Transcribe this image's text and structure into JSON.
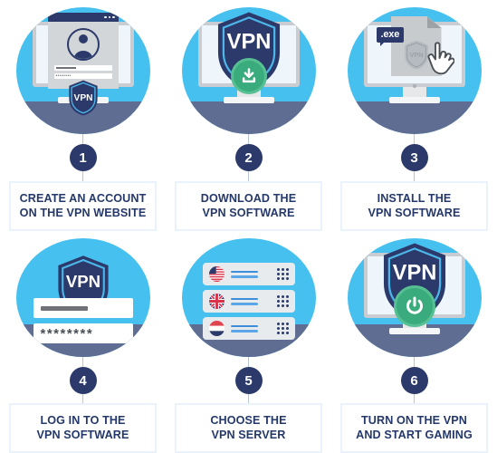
{
  "theme": {
    "circle_blue": "#45c0ef",
    "floor_slate": "#5f6d93",
    "navy": "#2b3a6b",
    "caption_text": "#25386b",
    "caption_border": "#eaf3fb",
    "green": "#3aab7c",
    "green_light": "#57c093",
    "screen_gray": "#c9cdd1"
  },
  "steps": [
    {
      "number": "1",
      "caption_line1": "CREATE AN ACCOUNT",
      "caption_line2": "ON THE VPN WEBSITE",
      "illustration": "monitor-with-login-browser",
      "shield_label": "VPN",
      "password_mask": "••••••••"
    },
    {
      "number": "2",
      "caption_line1": "DOWNLOAD THE",
      "caption_line2": "VPN SOFTWARE",
      "illustration": "monitor-with-download-shield",
      "shield_label": "VPN"
    },
    {
      "number": "3",
      "caption_line1": "INSTALL THE",
      "caption_line2": "VPN SOFTWARE",
      "illustration": "monitor-with-exe-file-and-cursor",
      "file_label": ".exe",
      "shield_label": "VPN"
    },
    {
      "number": "4",
      "caption_line1": "LOG IN TO THE",
      "caption_line2": "VPN SOFTWARE",
      "illustration": "shield-with-login-fields",
      "shield_label": "VPN",
      "password_mask": "********"
    },
    {
      "number": "5",
      "caption_line1": "CHOOSE THE",
      "caption_line2": "VPN SERVER",
      "illustration": "server-list-with-country-flags",
      "servers": [
        {
          "flag": "us-flag",
          "country": "United States"
        },
        {
          "flag": "uk-flag",
          "country": "United Kingdom"
        },
        {
          "flag": "nl-flag",
          "country": "Netherlands"
        }
      ]
    },
    {
      "number": "6",
      "caption_line1": "TURN ON THE VPN",
      "caption_line2": "AND START GAMING",
      "illustration": "monitor-with-power-button-shield",
      "shield_label": "VPN"
    }
  ]
}
